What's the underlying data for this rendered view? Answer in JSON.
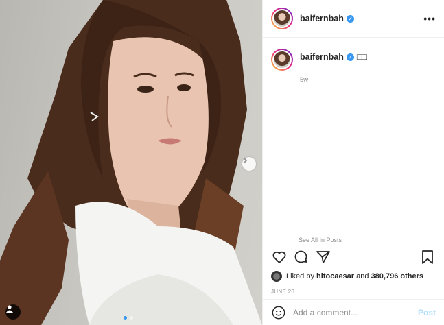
{
  "post": {
    "username": "baifernbah",
    "more_icon": "more-options-icon",
    "caption": "□□",
    "time_ago": "5w",
    "faded_text": "See All In Posts",
    "likes_prefix": "Liked by",
    "liked_by_user": "hitocaesar",
    "likes_connector": "and",
    "likes_count": "380,796 others",
    "date": "JUNE 26",
    "carousel": {
      "current": 1,
      "total": 2
    }
  },
  "comment": {
    "placeholder": "Add a comment...",
    "post_label": "Post"
  },
  "colors": {
    "verified": "#3897f0",
    "post_button_disabled": "#b2dffc",
    "border": "#efefef"
  }
}
